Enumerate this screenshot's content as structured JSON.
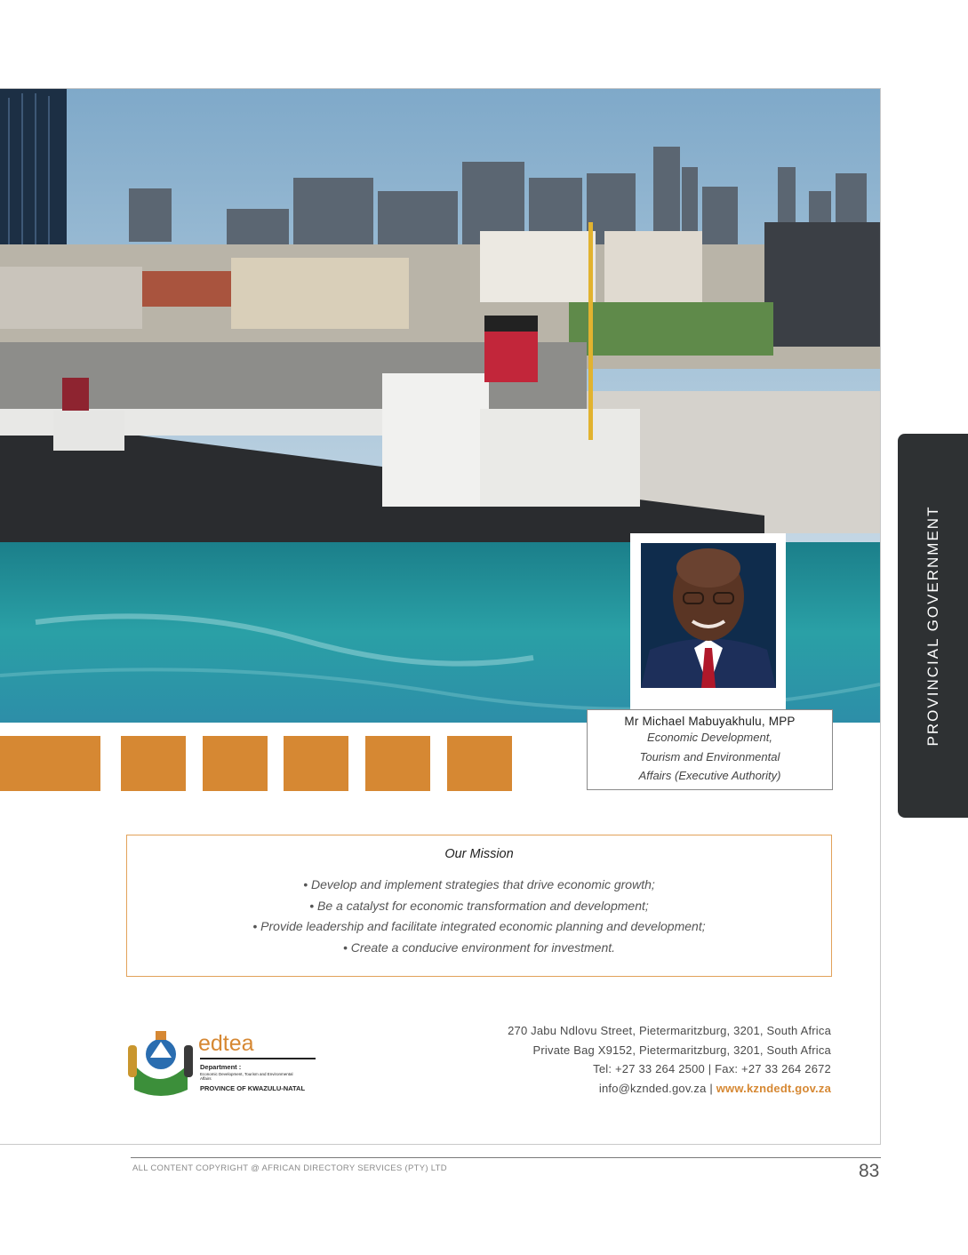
{
  "side_tab": {
    "label": "PROVINCIAL GOVERNMENT"
  },
  "official": {
    "name": "Mr Michael Mabuyakhulu, MPP",
    "role_lines": [
      "Economic Development,",
      "Tourism and Environmental",
      "Affairs (Executive Authority)"
    ]
  },
  "mission": {
    "title": "Our Mission",
    "items": [
      "• Develop and implement strategies that drive economic growth;",
      "• Be a catalyst for economic transformation and development;",
      "• Provide leadership and facilitate integrated economic planning and development;",
      "• Create a conducive environment for investment."
    ]
  },
  "logo": {
    "brand": "edtea",
    "department": "Department :",
    "department_name": "Economic Development, Tourism and Environmental Affairs",
    "province": "PROVINCE OF KWAZULU-NATAL"
  },
  "contact": {
    "line1": "270 Jabu Ndlovu Street, Pietermaritzburg, 3201, South Africa",
    "line2": "Private Bag X9152, Pietermaritzburg, 3201, South Africa",
    "line3": "Tel: +27 33 264 2500 | Fax: +27 33 264 2672",
    "email": "info@kznded.gov.za",
    "separator": " | ",
    "website": "www.kzndedt.gov.za"
  },
  "footer": {
    "copyright": "ALL CONTENT COPYRIGHT @ AFRICAN DIRECTORY SERVICES (PTY) LTD",
    "page_number": "83"
  },
  "colors": {
    "accent": "#d68833",
    "tab": "#2e3133",
    "water": "#1f8e95"
  }
}
